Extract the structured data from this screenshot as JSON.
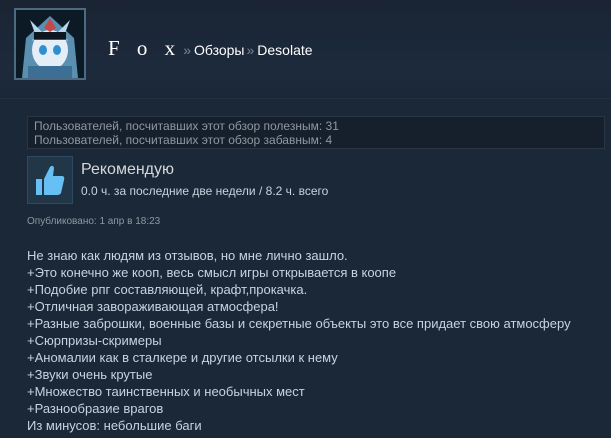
{
  "header": {
    "user_name": "F o x",
    "separator": "»",
    "section": "Обзоры",
    "game": "Desolate",
    "avatar_icon": "anime-character-avatar"
  },
  "stats": {
    "helpful": "Пользователей, посчитавших этот обзор полезным: 31",
    "funny": "Пользователей, посчитавших этот обзор забавным: 4"
  },
  "verdict": {
    "icon": "thumbs-up-icon",
    "title": "Рекомендую",
    "playtime": "0.0 ч. за последние две недели / 8.2 ч. всего"
  },
  "posted": "Опубликовано: 1 апр в 18:23",
  "review": {
    "lines": [
      "Не знаю как людям из отзывов, но мне лично зашло.",
      "+Это конечно же кооп, весь смысл игры открывается в коопе",
      "+Подобие рпг составляющей, крафт,прокачка.",
      "+Отличная завораживающая атмосфера!",
      "+Разные заброшки, военные базы и секретные объекты это все придает свою атмосферу",
      "+Сюрпризы-скримеры",
      "+Аномалии как в сталкере и другие отсылки к нему",
      "+Звуки очень крутые",
      "+Множество таинственных и необычных мест",
      "+Разнообразие врагов",
      "Из минусов: небольшие баги"
    ]
  },
  "colors": {
    "background": "#1b2838",
    "accent": "#67c1f5",
    "text": "#c6d4df",
    "muted": "#8f98a0"
  }
}
